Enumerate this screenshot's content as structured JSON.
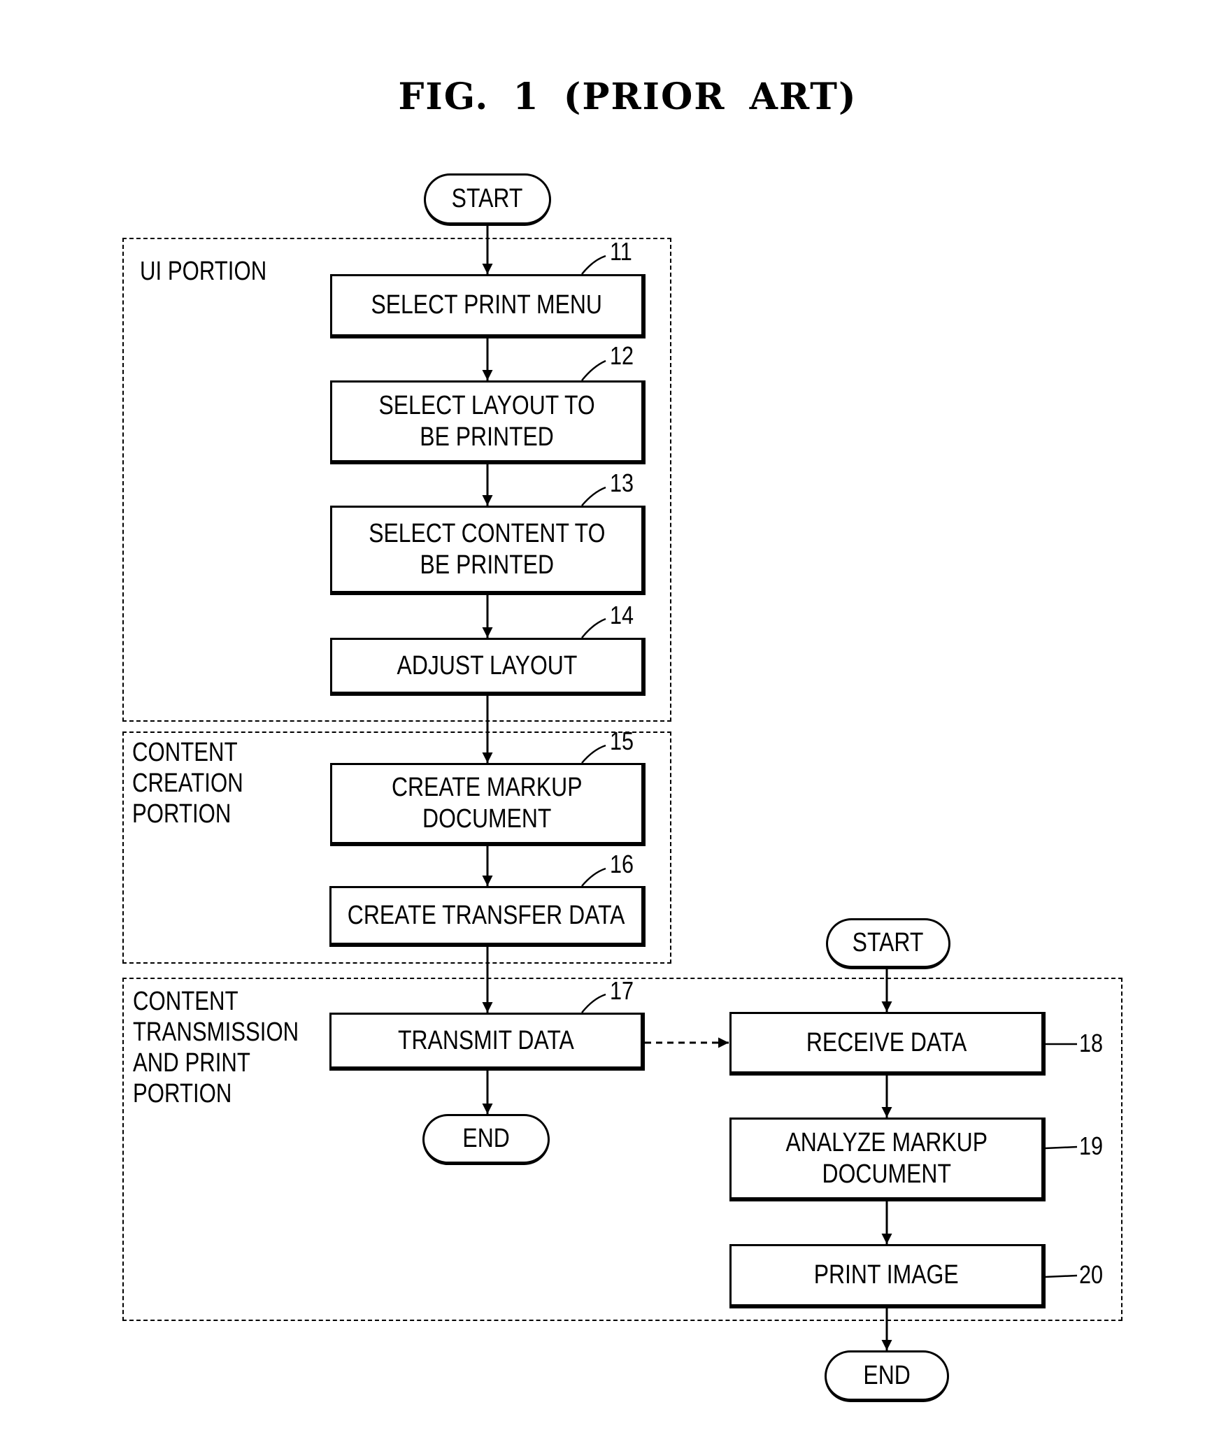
{
  "figure": {
    "title": "FIG. 1 (PRIOR ART)"
  },
  "portions": {
    "ui": {
      "label": "UI PORTION"
    },
    "creation": {
      "label": "CONTENT\nCREATION\nPORTION"
    },
    "transmission": {
      "label": "CONTENT\nTRANSMISSION\nAND PRINT\nPORTION"
    }
  },
  "terminals": {
    "start_left": "START",
    "end_left": "END",
    "start_right": "START",
    "end_right": "END"
  },
  "steps": [
    {
      "ref": "11",
      "label": "SELECT PRINT MENU"
    },
    {
      "ref": "12",
      "label": "SELECT LAYOUT TO\nBE PRINTED"
    },
    {
      "ref": "13",
      "label": "SELECT CONTENT TO\nBE PRINTED"
    },
    {
      "ref": "14",
      "label": "ADJUST LAYOUT"
    },
    {
      "ref": "15",
      "label": "CREATE MARKUP\nDOCUMENT"
    },
    {
      "ref": "16",
      "label": "CREATE TRANSFER DATA"
    },
    {
      "ref": "17",
      "label": "TRANSMIT DATA"
    },
    {
      "ref": "18",
      "label": "RECEIVE DATA"
    },
    {
      "ref": "19",
      "label": "ANALYZE MARKUP\nDOCUMENT"
    },
    {
      "ref": "20",
      "label": "PRINT IMAGE"
    }
  ],
  "connections": [
    {
      "from": "start_left",
      "to": "11",
      "style": "solid"
    },
    {
      "from": "11",
      "to": "12",
      "style": "solid"
    },
    {
      "from": "12",
      "to": "13",
      "style": "solid"
    },
    {
      "from": "13",
      "to": "14",
      "style": "solid"
    },
    {
      "from": "14",
      "to": "15",
      "style": "solid"
    },
    {
      "from": "15",
      "to": "16",
      "style": "solid"
    },
    {
      "from": "16",
      "to": "17",
      "style": "solid"
    },
    {
      "from": "17",
      "to": "end_left",
      "style": "solid"
    },
    {
      "from": "17",
      "to": "18",
      "style": "dashed"
    },
    {
      "from": "start_right",
      "to": "18",
      "style": "solid"
    },
    {
      "from": "18",
      "to": "19",
      "style": "solid"
    },
    {
      "from": "19",
      "to": "20",
      "style": "solid"
    },
    {
      "from": "20",
      "to": "end_right",
      "style": "solid"
    }
  ]
}
